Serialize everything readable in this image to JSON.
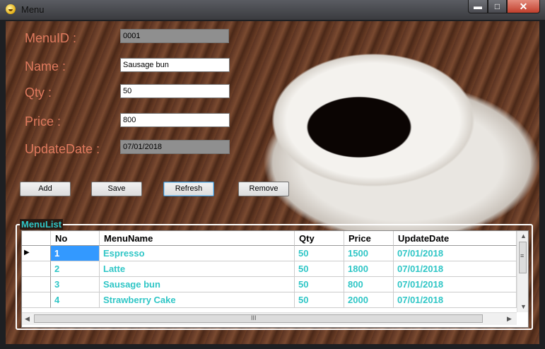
{
  "window": {
    "title": "Menu",
    "min_label": "▬",
    "max_label": "□",
    "close_label": "✕"
  },
  "form": {
    "menu_id_label": "MenuID :",
    "menu_id_value": "0001",
    "name_label": "Name :",
    "name_value": "Sausage bun",
    "qty_label": "Qty :",
    "qty_value": "50",
    "price_label": "Price :",
    "price_value": "800",
    "update_date_label": "UpdateDate :",
    "update_date_value": "07/01/2018"
  },
  "buttons": {
    "add": "Add",
    "save": "Save",
    "refresh": "Refresh",
    "remove": "Remove"
  },
  "menulist": {
    "title": "MenuList",
    "columns": [
      "No",
      "MenuName",
      "Qty",
      "Price",
      "UpdateDate"
    ],
    "rows": [
      [
        "1",
        "Espresso",
        "50",
        "1500",
        "07/01/2018"
      ],
      [
        "2",
        "Latte",
        "50",
        "1800",
        "07/01/2018"
      ],
      [
        "3",
        "Sausage bun",
        "50",
        "800",
        "07/01/2018"
      ],
      [
        "4",
        "Strawberry Cake",
        "50",
        "2000",
        "07/01/2018"
      ]
    ],
    "current_row_marker": "▶",
    "scroll_grip": "≡",
    "hscroll_grip": "III"
  },
  "colors": {
    "label_color": "#e07a5e",
    "cell_text": "#2fc6c6",
    "selection": "#3399ff"
  }
}
